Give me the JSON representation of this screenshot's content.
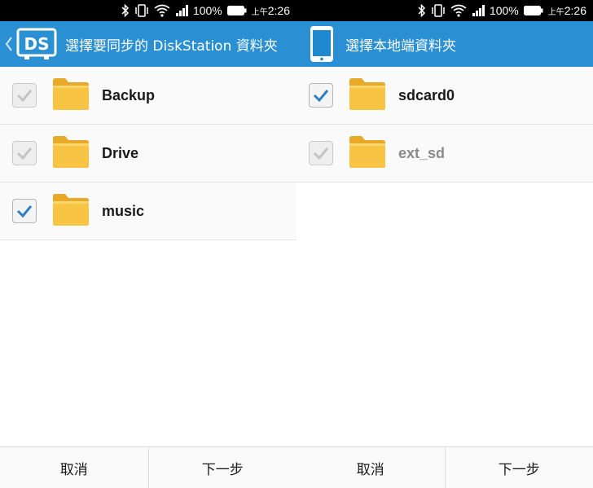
{
  "status_bar": {
    "battery": "100%",
    "time_prefix": "上午",
    "time": "2:26"
  },
  "colors": {
    "appbar": "#2b8fd3",
    "checked": "#2f7fc2",
    "folder": "#f7c444"
  },
  "left": {
    "title": "選擇要同步的 DiskStation 資料夾",
    "logo_text": "DS",
    "folders": [
      {
        "name": "Backup",
        "checked": true,
        "disabled": true
      },
      {
        "name": "Drive",
        "checked": true,
        "disabled": true
      },
      {
        "name": "music",
        "checked": true,
        "disabled": false
      }
    ],
    "buttons": {
      "cancel": "取消",
      "next": "下一步"
    }
  },
  "right": {
    "title": "選擇本地端資料夾",
    "folders": [
      {
        "name": "sdcard0",
        "checked": true,
        "disabled": false
      },
      {
        "name": "ext_sd",
        "checked": true,
        "disabled": true
      }
    ],
    "buttons": {
      "cancel": "取消",
      "next": "下一步"
    }
  }
}
